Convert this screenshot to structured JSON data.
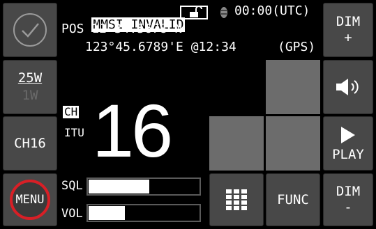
{
  "header": {
    "mmsi": "MMSI INVALID",
    "time": "00:00(UTC)",
    "pos_line1": "POS 12°34.5678'N",
    "pos_line2": "123°45.6789'E @12:34",
    "pos_source": "(GPS)"
  },
  "buttons": {
    "dim_up_label": "DIM",
    "dim_up_sign": "+",
    "power_high": "25W",
    "power_low": "1W",
    "ch16": "CH16",
    "play": "PLAY",
    "menu": "MENU",
    "func": "FUNC",
    "dim_down_label": "DIM",
    "dim_down_sign": "-"
  },
  "channel": {
    "ch_label": "CH",
    "mode": "ITU",
    "number": "16"
  },
  "levels": {
    "sql_label": "SQL",
    "sql_fraction": 0.55,
    "vol_label": "VOL",
    "vol_fraction": 0.33
  },
  "icons": {
    "check": "check-circle-icon",
    "unlock": "unlock-icon",
    "gps": "gps-satellite-icon",
    "speaker": "speaker-icon",
    "play": "play-icon",
    "keypad": "keypad-icon"
  },
  "colors": {
    "menu_ring": "#d81f26",
    "button_bg": "#484848",
    "panel_bg": "#6c6c6c"
  }
}
